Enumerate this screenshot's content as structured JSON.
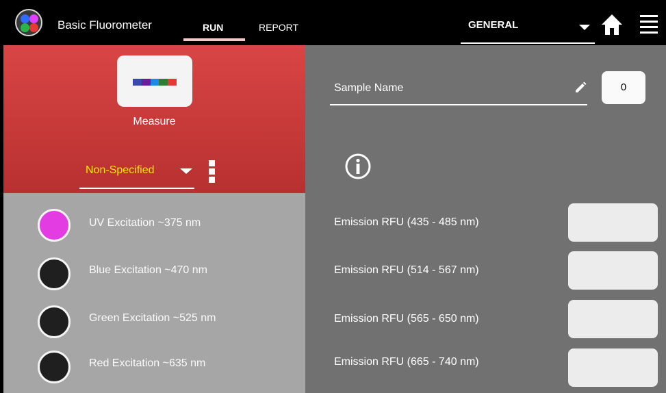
{
  "app": {
    "title": "Basic Fluorometer",
    "logo_dot_colors": [
      "#2f6bff",
      "#e040fb",
      "#29b34a",
      "#e53935"
    ]
  },
  "tabs": [
    {
      "label": "RUN",
      "active": true
    },
    {
      "label": "REPORT",
      "active": false
    }
  ],
  "header": {
    "mode_select": "GENERAL",
    "icons": [
      "chevron-down-icon",
      "home-icon",
      "menu-icon"
    ]
  },
  "measure": {
    "label": "Measure",
    "bar_colors": [
      "#3949ab",
      "#6a1b9a",
      "#1e88e5",
      "#2e7d32",
      "#e53935"
    ]
  },
  "assay_select": {
    "value": "Non-Specified"
  },
  "excitations": [
    {
      "label": "UV Excitation ~375 nm",
      "color": "#e33ce3",
      "selected": true
    },
    {
      "label": "Blue Excitation ~470 nm",
      "color": "#1f1f1f",
      "selected": false
    },
    {
      "label": "Green Excitation ~525 nm",
      "color": "#1f1f1f",
      "selected": false
    },
    {
      "label": "Red Excitation ~635 nm",
      "color": "#1f1f1f",
      "selected": false
    }
  ],
  "sample": {
    "placeholder": "Sample Name",
    "counter": "0"
  },
  "emissions": [
    {
      "label": "Emission RFU (435 - 485 nm)",
      "value": ""
    },
    {
      "label": "Emission RFU (514 - 567 nm)",
      "value": ""
    },
    {
      "label": "Emission RFU (565 - 650 nm)",
      "value": ""
    },
    {
      "label": "Emission RFU (665 - 740 nm)",
      "value": ""
    }
  ],
  "colors": {
    "red_panel": "#c93a3a",
    "left_list_bg": "#a6a6a6",
    "right_panel_bg": "#717171",
    "accent_yellow": "#ffe800"
  }
}
